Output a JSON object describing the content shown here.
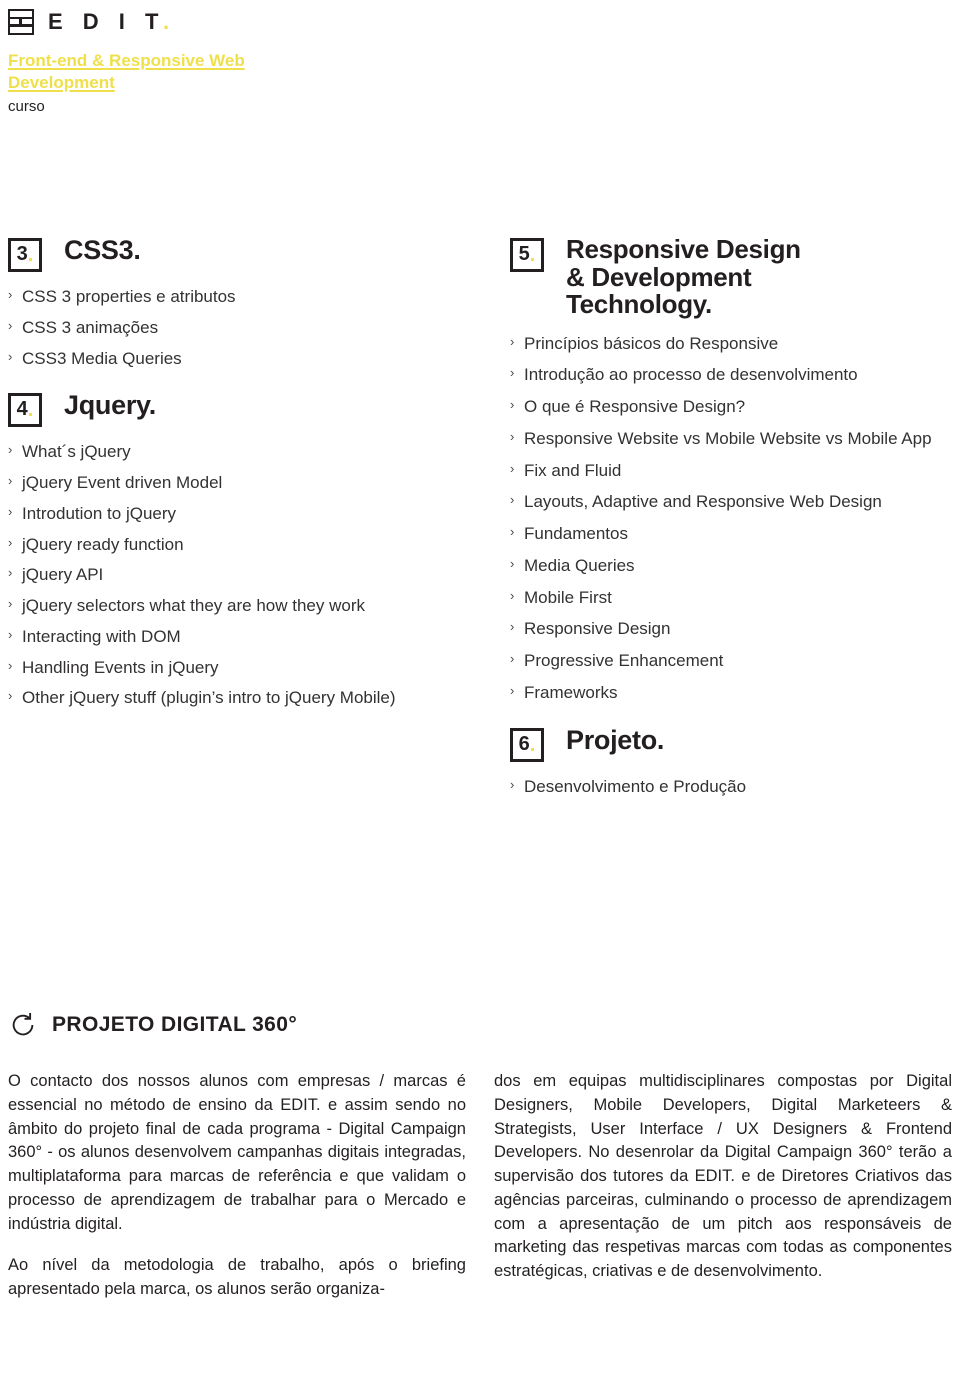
{
  "brand": {
    "logo_icon": "edit-grid-logo-icon",
    "logo_text": "E D I T",
    "logo_dot": ".",
    "course_title": "Front-end & Responsive Web Development",
    "course_kicker": "curso",
    "accent_color": "#efe04b",
    "ink_color": "#231f20"
  },
  "modules": {
    "left": [
      {
        "number": "3",
        "dot": ".",
        "title": "CSS3.",
        "topics": [
          "CSS 3 properties e atributos",
          "CSS 3 animações",
          "CSS3 Media Queries"
        ]
      },
      {
        "number": "4",
        "dot": ".",
        "title": "Jquery.",
        "topics": [
          "What´s jQuery",
          "jQuery Event driven Model",
          "Introdution to jQuery",
          "jQuery ready function",
          "jQuery API",
          "jQuery selectors what they are how they work",
          "Interacting with DOM",
          "Handling Events in jQuery",
          "Other jQuery stuff (plugin’s intro to jQuery Mobile)"
        ]
      }
    ],
    "right": [
      {
        "number": "5",
        "dot": ".",
        "title": "Responsive Design\n& Development\nTechnology.",
        "topics": [
          "Princípios básicos do Responsive",
          "Introdução ao processo de desenvolvimento",
          "O que é Responsive Design?",
          "Responsive Website vs Mobile Website vs Mobile App",
          "Fix and Fluid",
          "Layouts, Adaptive and Responsive Web Design",
          "Fundamentos",
          "Media Queries",
          "Mobile First",
          "Responsive Design",
          "Progressive Enhancement",
          "Frameworks"
        ]
      },
      {
        "number": "6",
        "dot": ".",
        "title": "Projeto.",
        "topics": [
          "Desenvolvimento e Produção"
        ]
      }
    ]
  },
  "bullet_glyph": "›",
  "projeto_digital": {
    "icon": "refresh-circle-360-icon",
    "title": "PROJETO DIGITAL 360°",
    "left_paragraphs": [
      "O contacto dos nossos alunos com empresas / marcas é essencial no método de ensino da EDIT. e assim sendo no âmbito do projeto final de cada programa - Digital Campaign 360° - os alunos desenvolvem campanhas digitais integradas, multiplataforma para marcas de referência e que validam o processo de aprendizagem de trabalhar para o Mercado e indústria digital.",
      "Ao nível da metodologia de trabalho, após o briefing apresentado pela marca, os alunos serão organiza-"
    ],
    "right_paragraphs": [
      "dos em equipas multidisciplinares compostas por Digital Designers, Mobile Developers, Digital Marketeers & Strategists, User Interface / UX Designers & Frontend Developers. No desenrolar da Digital Campaign 360° terão a supervisão dos tutores da EDIT. e de Diretores Criativos das agências parceiras, culminando o processo de aprendizagem com a apresentação de um pitch aos responsáveis de marketing das respetivas marcas com todas as componentes estratégicas, criativas e de desenvolvimento."
    ]
  }
}
